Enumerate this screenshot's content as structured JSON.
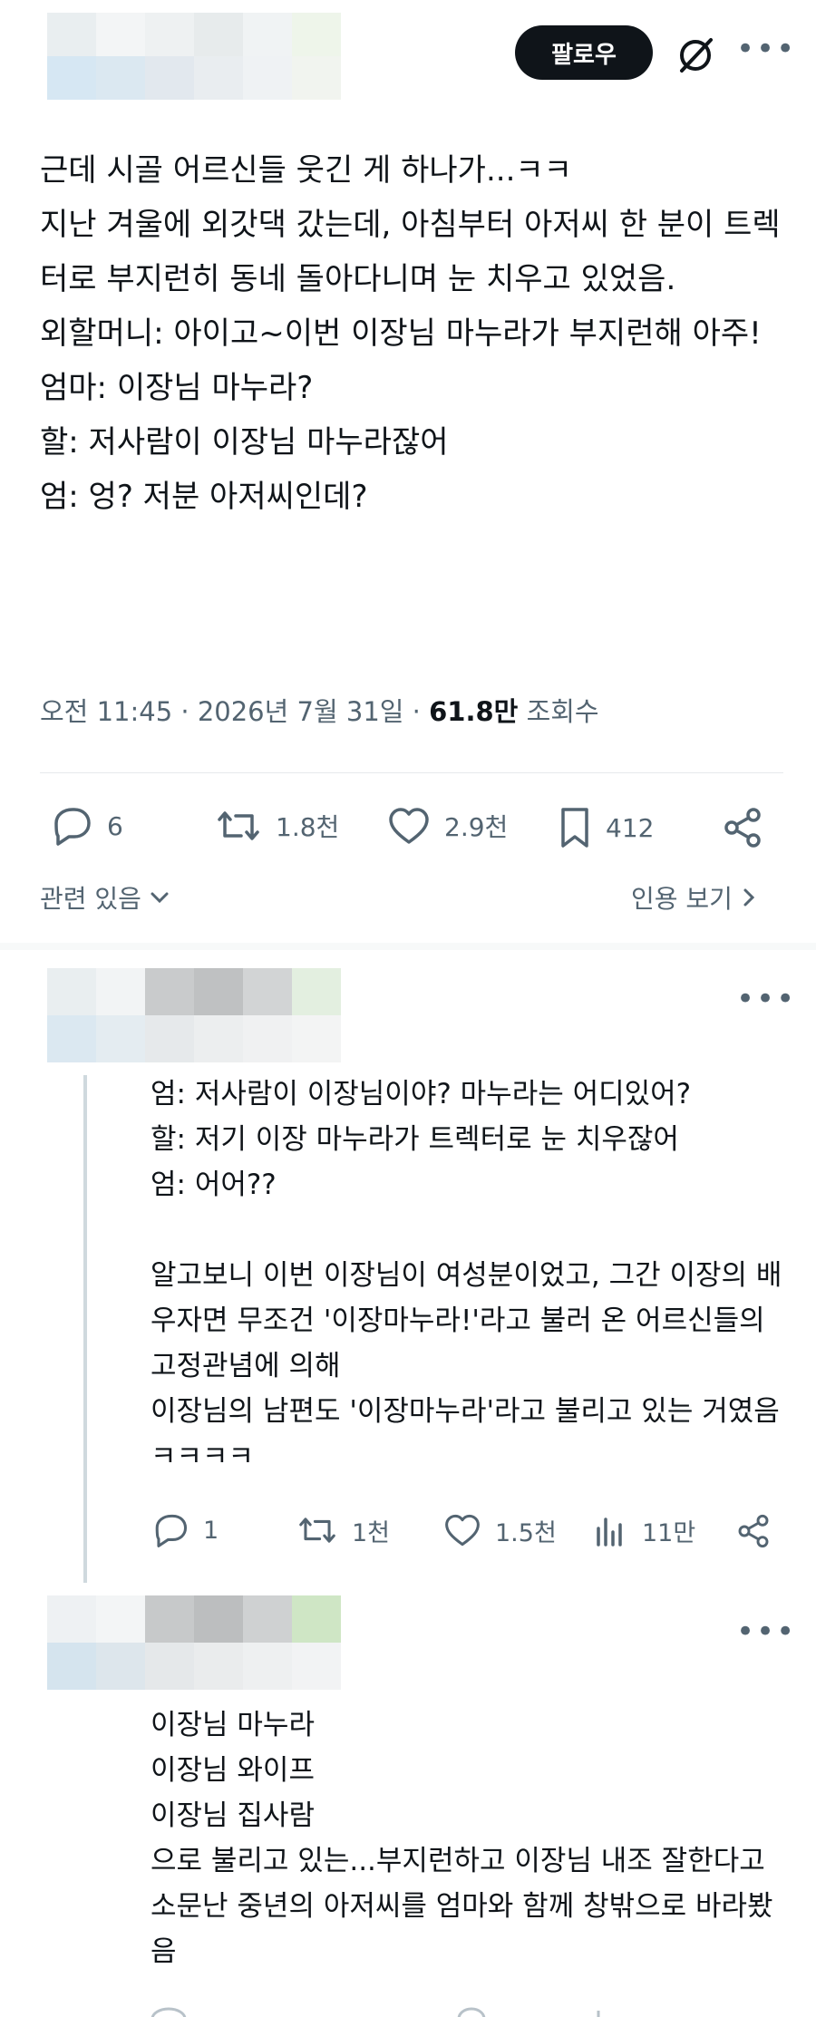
{
  "header": {
    "follow_label": "팔로우"
  },
  "post": {
    "text": "근데 시골 어르신들 웃긴 게 하나가...ㅋㅋ\n지난 겨울에 외갓댁 갔는데, 아침부터 아저씨 한 분이 트렉터로 부지런히 동네 돌아다니며 눈 치우고 있었음.\n외할머니: 아이고~이번 이장님 마누라가 부지런해 아주!\n엄마: 이장님 마누라?\n할: 저사람이 이장님 마누라잖어\n엄: 엉? 저분 아저씨인데?",
    "time": "오전 11:45",
    "date": "2026년 7월 31일",
    "views": "61.8만",
    "views_label": "조회수",
    "replies": "6",
    "reposts": "1.8천",
    "likes": "2.9천",
    "bookmarks": "412",
    "related_label": "관련 있음",
    "quotes_label": "인용 보기"
  },
  "reply1": {
    "text": "엄: 저사람이 이장님이야? 마누라는 어디있어?\n할: 저기 이장 마누라가 트렉터로 눈 치우잖어\n엄: 어어??\n\n알고보니 이번 이장님이 여성분이었고, 그간 이장의 배우자면 무조건 '이장마누라!'라고 불러 온 어르신들의 고정관념에 의해\n이장님의 남편도 '이장마누라'라고 불리고 있는 거였음ㅋㅋㅋㅋ",
    "replies": "1",
    "reposts": "1천",
    "likes": "1.5천",
    "views": "11만"
  },
  "reply2": {
    "text": "이장님 마누라\n이장님 와이프\n이장님 집사람\n으로 불리고 있는...부지런하고 이장님 내조 잘한다고 소문난 중년의 아저씨를 엄마와 함께 창밖으로 바라봤음"
  },
  "colors": {
    "text": "#0f1419",
    "muted": "#536471",
    "button_bg": "#0f1419"
  },
  "icons": [
    "no-entry-icon",
    "more-icon",
    "reply-icon",
    "repost-icon",
    "like-icon",
    "bookmark-icon",
    "share-icon",
    "chevron-down-icon",
    "chevron-right-icon",
    "views-icon"
  ]
}
